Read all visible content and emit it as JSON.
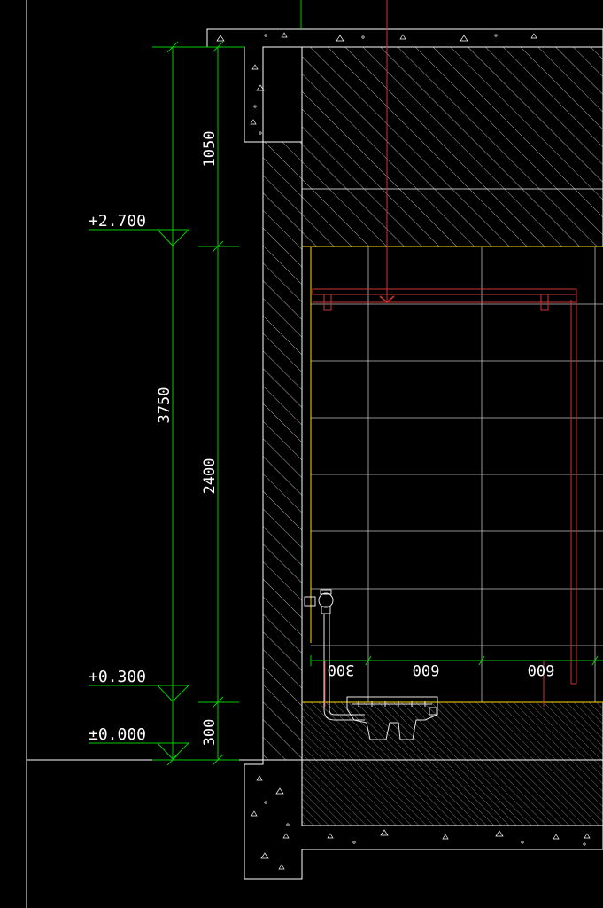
{
  "drawing": {
    "colors": {
      "background": "#000000",
      "structure": "#ffffff",
      "dimension": "#00cc00",
      "tile_grid": "#bfbfbf",
      "pipe": "#cc3333",
      "finish_line": "#ffd700"
    },
    "levels": [
      {
        "label": "+2.700",
        "value_m": 2.7
      },
      {
        "label": "+0.300",
        "value_m": 0.3
      },
      {
        "label": "±0.000",
        "value_m": 0.0
      }
    ],
    "vertical_dimensions": {
      "overall": {
        "label": "3750",
        "value_mm": 3750
      },
      "segments": [
        {
          "label": "1050",
          "value_mm": 1050
        },
        {
          "label": "2400",
          "value_mm": 2400
        },
        {
          "label": "300",
          "value_mm": 300
        }
      ]
    },
    "horizontal_dimensions": [
      {
        "label": "300",
        "value_mm": 300
      },
      {
        "label": "600",
        "value_mm": 600
      },
      {
        "label": "600",
        "value_mm": 600
      }
    ],
    "fixture_icon": "squat-toilet-icon",
    "valve_icon": "flush-valve-icon"
  }
}
